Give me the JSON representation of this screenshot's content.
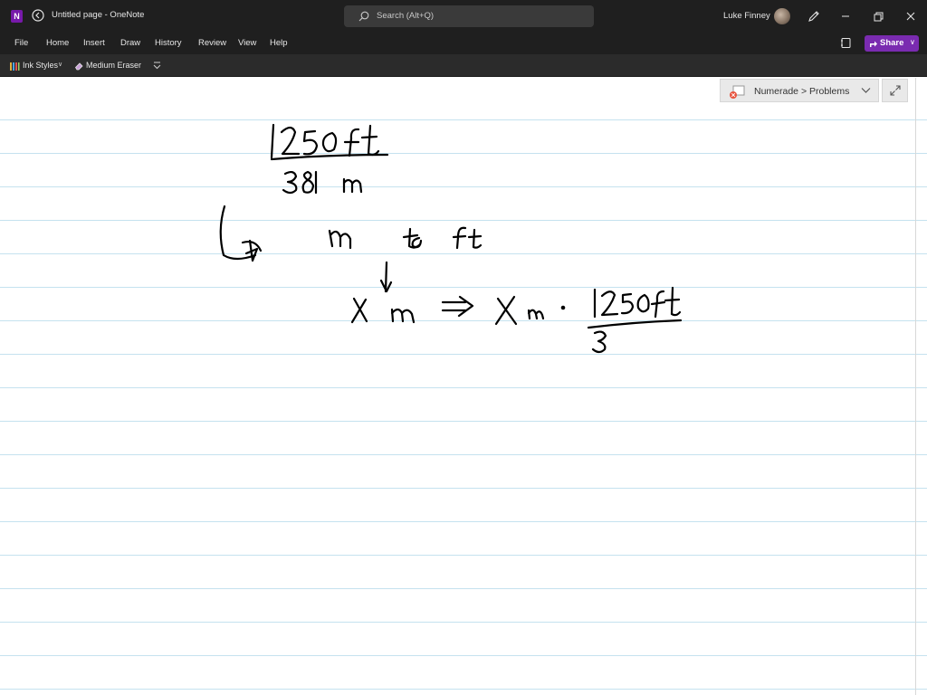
{
  "titlebar": {
    "app_icon_letter": "N",
    "title": "Untitled page  -  OneNote",
    "search_placeholder": "Search (Alt+Q)",
    "user_name": "Luke Finney"
  },
  "menu": {
    "items": [
      "File",
      "Home",
      "Insert",
      "Draw",
      "History",
      "Review",
      "View",
      "Help"
    ],
    "share_label": "Share"
  },
  "toolbar": {
    "ink_styles_label": "Ink Styles",
    "eraser_label": "Medium Eraser"
  },
  "page": {
    "breadcrumb": "Numerade > Problems"
  },
  "colors": {
    "accent": "#7a2bb0",
    "rule_lines": "#c5e2ef",
    "ink": "#000000"
  },
  "icons": [
    "onenote-icon",
    "back-icon",
    "search-icon",
    "pen-icon",
    "minimize-icon",
    "restore-icon",
    "close-icon",
    "notebook-icon",
    "share-icon",
    "ink-styles-icon",
    "eraser-icon",
    "overflow-icon",
    "page-status-icon",
    "chevron-down-icon",
    "expand-icon"
  ]
}
